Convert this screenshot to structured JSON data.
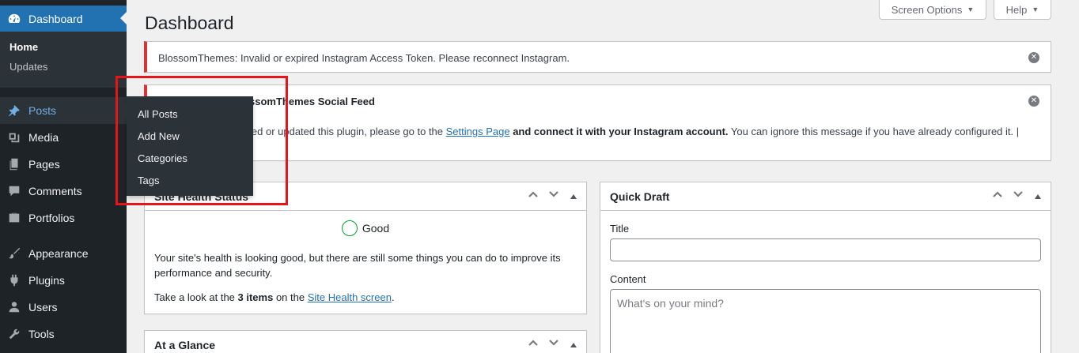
{
  "sidebar": {
    "dashboard_label": "Dashboard",
    "submenu": [
      {
        "label": "Home"
      },
      {
        "label": "Updates"
      }
    ],
    "items": [
      {
        "label": "Posts",
        "icon": "pin-icon"
      },
      {
        "label": "Media",
        "icon": "media-icon"
      },
      {
        "label": "Pages",
        "icon": "pages-icon"
      },
      {
        "label": "Comments",
        "icon": "comments-icon"
      },
      {
        "label": "Portfolios",
        "icon": "portfolio-icon"
      },
      {
        "label": "Appearance",
        "icon": "brush-icon"
      },
      {
        "label": "Plugins",
        "icon": "plugin-icon"
      },
      {
        "label": "Users",
        "icon": "user-icon"
      },
      {
        "label": "Tools",
        "icon": "wrench-icon"
      }
    ]
  },
  "flyout": {
    "items": [
      {
        "label": "All Posts"
      },
      {
        "label": "Add New"
      },
      {
        "label": "Categories"
      },
      {
        "label": "Tags"
      }
    ]
  },
  "header": {
    "title": "Dashboard",
    "screen_options": "Screen Options",
    "help": "Help"
  },
  "notices": {
    "first": "BlossomThemes: Invalid or expired Instagram Access Token. Please reconnect Instagram.",
    "second_title": "ssomThemes Social Feed",
    "second_prefix": "led or updated this plugin, please go to the ",
    "second_link": "Settings Page",
    "second_bold": " and connect it with your Instagram account.",
    "second_suffix": " You can ignore this message if you have already configured it. |"
  },
  "site_health": {
    "title": "Site Health Status",
    "status": "Good",
    "body": "Your site's health is looking good, but there are still some things you can do to improve its performance and security.",
    "look_prefix": "Take a look at the ",
    "look_bold": "3 items",
    "look_mid": " on the ",
    "look_link": "Site Health screen",
    "look_end": "."
  },
  "quick_draft": {
    "title": "Quick Draft",
    "title_label": "Title",
    "content_label": "Content",
    "content_placeholder": "What's on your mind?"
  },
  "at_a_glance": {
    "title": "At a Glance"
  },
  "colors": {
    "sidebar_bg": "#1d2327",
    "accent": "#2271b1",
    "error": "#d63638",
    "highlight_box": "#e8141b",
    "good": "#00a32a"
  }
}
